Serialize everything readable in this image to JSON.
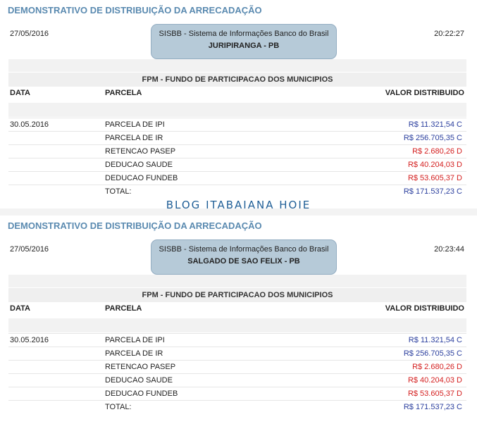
{
  "watermark": "BLOG ITABAIANA HOJE",
  "colors": {
    "heading": "#5a8ab0",
    "credit": "#2b3f9e",
    "debit": "#d42020",
    "banner": "#b6cad8"
  },
  "reports": [
    {
      "heading": "DEMONSTRATIVO DE DISTRIBUIÇÃO DA ARRECADAÇÃO",
      "date": "27/05/2016",
      "time": "20:22:27",
      "banner_line1": "SISBB - Sistema de Informações Banco do Brasil",
      "banner_line2": "JURIPIRANGA - PB",
      "section_title": "FPM - FUNDO DE PARTICIPACAO DOS MUNICIPIOS",
      "col_data": "DATA",
      "col_parcela": "PARCELA",
      "col_valor": "VALOR DISTRIBUIDO",
      "rows": [
        {
          "date": "30.05.2016",
          "parcela": "PARCELA DE IPI",
          "valor": "R$ 11.321,54 C",
          "kind": "credit"
        },
        {
          "date": "",
          "parcela": "PARCELA DE IR",
          "valor": "R$ 256.705,35 C",
          "kind": "credit"
        },
        {
          "date": "",
          "parcela": "RETENCAO PASEP",
          "valor": "R$ 2.680,26 D",
          "kind": "debit"
        },
        {
          "date": "",
          "parcela": "DEDUCAO SAUDE",
          "valor": "R$ 40.204,03 D",
          "kind": "debit"
        },
        {
          "date": "",
          "parcela": "DEDUCAO FUNDEB",
          "valor": "R$ 53.605,37 D",
          "kind": "debit"
        },
        {
          "date": "",
          "parcela": "TOTAL:",
          "valor": "R$ 171.537,23 C",
          "kind": "credit"
        }
      ]
    },
    {
      "heading": "DEMONSTRATIVO DE DISTRIBUIÇÃO DA ARRECADAÇÃO",
      "date": "27/05/2016",
      "time": "20:23:44",
      "banner_line1": "SISBB - Sistema de Informações Banco do Brasil",
      "banner_line2": "SALGADO DE SAO FELIX - PB",
      "section_title": "FPM - FUNDO DE PARTICIPACAO DOS MUNICIPIOS",
      "col_data": "DATA",
      "col_parcela": "PARCELA",
      "col_valor": "VALOR DISTRIBUIDO",
      "rows": [
        {
          "date": "30.05.2016",
          "parcela": "PARCELA DE IPI",
          "valor": "R$ 11.321,54 C",
          "kind": "credit"
        },
        {
          "date": "",
          "parcela": "PARCELA DE IR",
          "valor": "R$ 256.705,35 C",
          "kind": "credit"
        },
        {
          "date": "",
          "parcela": "RETENCAO PASEP",
          "valor": "R$ 2.680,26 D",
          "kind": "debit"
        },
        {
          "date": "",
          "parcela": "DEDUCAO SAUDE",
          "valor": "R$ 40.204,03 D",
          "kind": "debit"
        },
        {
          "date": "",
          "parcela": "DEDUCAO FUNDEB",
          "valor": "R$ 53.605,37 D",
          "kind": "debit"
        },
        {
          "date": "",
          "parcela": "TOTAL:",
          "valor": "R$ 171.537,23 C",
          "kind": "credit"
        }
      ]
    }
  ]
}
